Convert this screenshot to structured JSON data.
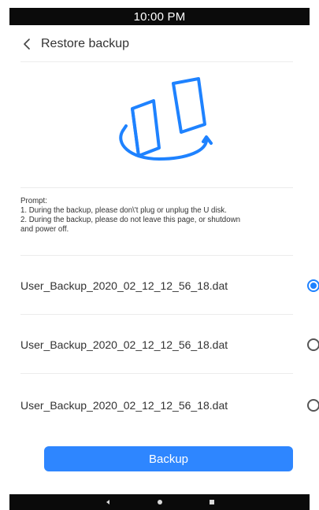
{
  "status_bar": {
    "time": "10:00 PM"
  },
  "header": {
    "title": "Restore backup",
    "back_icon": "chevron-left-icon"
  },
  "hero": {
    "icon": "restore-backup-illustration-icon",
    "color": "#1e82ff"
  },
  "prompt": {
    "heading": "Prompt:",
    "line1": "1. During the backup, please don\\'t plug or unplug the U disk.",
    "line2": "2. During the backup, please do not leave this page, or  shutdown",
    "line3": "and power off."
  },
  "files": [
    {
      "name": "User_Backup_2020_02_12_12_56_18.dat",
      "selected": true
    },
    {
      "name": "User_Backup_2020_02_12_12_56_18.dat",
      "selected": false
    },
    {
      "name": "User_Backup_2020_02_12_12_56_18.dat",
      "selected": false
    }
  ],
  "actions": {
    "backup_label": "Backup"
  },
  "nav_bar": {
    "back_icon": "nav-back-icon",
    "home_icon": "nav-home-icon",
    "recents_icon": "nav-recents-icon"
  }
}
